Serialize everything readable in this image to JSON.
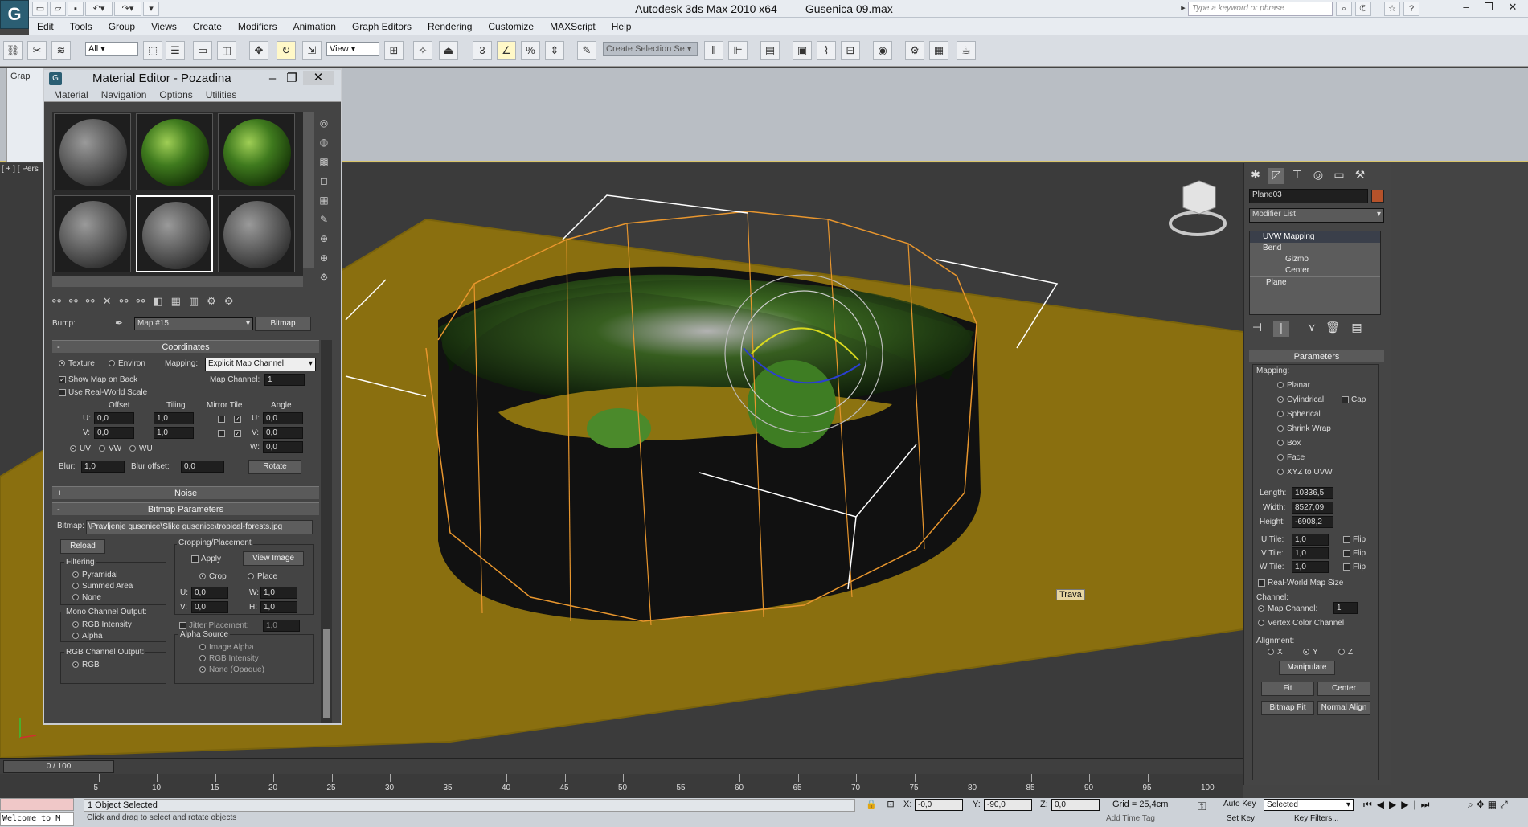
{
  "app": {
    "title": "Autodesk 3ds Max  2010 x64",
    "file": "Gusenica 09.max",
    "search_placeholder": "Type a keyword or phrase"
  },
  "menu": [
    "Edit",
    "Tools",
    "Group",
    "Views",
    "Create",
    "Modifiers",
    "Animation",
    "Graph Editors",
    "Rendering",
    "Customize",
    "MAXScript",
    "Help"
  ],
  "toolbar": {
    "filter": "All",
    "coord": "View",
    "selection_set": "Create Selection Se"
  },
  "viewport": {
    "label": "[ + ] [ Pers",
    "tab_label": "Grap",
    "tooltip": "Trava"
  },
  "material_editor": {
    "title": "Material Editor - Pozadina",
    "menu": [
      "Material",
      "Navigation",
      "Options",
      "Utilities"
    ],
    "bump_label": "Bump:",
    "map_name": "Map #15",
    "map_type": "Bitmap",
    "coordinates": {
      "header": "Coordinates",
      "texture": "Texture",
      "environ": "Environ",
      "mapping_label": "Mapping:",
      "mapping": "Explicit Map Channel",
      "show_map_back": "Show Map on Back",
      "map_channel_label": "Map Channel:",
      "map_channel": "1",
      "real_world": "Use Real-World Scale",
      "offset": "Offset",
      "tiling": "Tiling",
      "mirror_tile": "Mirror Tile",
      "angle": "Angle",
      "u_label": "U:",
      "v_label": "V:",
      "w_label": "W:",
      "u_offset": "0,0",
      "v_offset": "0,0",
      "u_tiling": "1,0",
      "v_tiling": "1,0",
      "u_angle": "0,0",
      "v_angle": "0,0",
      "w_angle": "0,0",
      "uv": "UV",
      "vw": "VW",
      "wu": "WU",
      "blur_label": "Blur:",
      "blur": "1,0",
      "blur_offset_label": "Blur offset:",
      "blur_offset": "0,0",
      "rotate": "Rotate"
    },
    "noise": "Noise",
    "bitmap_params": {
      "header": "Bitmap Parameters",
      "bitmap_label": "Bitmap:",
      "bitmap": "\\Pravljenje gusenice\\Slike gusenice\\tropical-forests.jpg",
      "reload": "Reload",
      "cropping": "Cropping/Placement",
      "apply": "Apply",
      "view_image": "View Image",
      "crop": "Crop",
      "place": "Place",
      "u_label": "U:",
      "v_label": "V:",
      "w_label": "W:",
      "h_label": "H:",
      "u": "0,0",
      "v": "0,0",
      "w": "1,0",
      "h": "1,0",
      "jitter": "Jitter Placement:",
      "jitter_val": "1,0",
      "filtering": "Filtering",
      "pyramidal": "Pyramidal",
      "summed": "Summed Area",
      "none": "None",
      "mono": "Mono Channel Output:",
      "rgb_intensity": "RGB Intensity",
      "alpha": "Alpha",
      "rgb_out": "RGB Channel Output:",
      "rgb": "RGB",
      "alpha_source": "Alpha Source",
      "image_alpha": "Image Alpha",
      "rgb_intensity2": "RGB Intensity",
      "none_opaque": "None (Opaque)"
    }
  },
  "command_panel": {
    "object_name": "Plane03",
    "object_color": "#b5522a",
    "modifier_list": "Modifier List",
    "stack": [
      "UVW Mapping",
      "Bend",
      "Gizmo",
      "Center",
      "Plane"
    ],
    "parameters": "Parameters",
    "mapping_label": "Mapping:",
    "mapping_types": [
      "Planar",
      "Cylindrical",
      "Spherical",
      "Shrink Wrap",
      "Box",
      "Face",
      "XYZ to UVW"
    ],
    "cap": "Cap",
    "length_label": "Length:",
    "length": "10336,5",
    "width_label": "Width:",
    "width": "8527,09",
    "height_label": "Height:",
    "height": "-6908,2",
    "u_tile_label": "U Tile:",
    "u_tile": "1,0",
    "v_tile_label": "V Tile:",
    "v_tile": "1,0",
    "w_tile_label": "W Tile:",
    "w_tile": "1,0",
    "flip": "Flip",
    "real_world": "Real-World Map Size",
    "channel_label": "Channel:",
    "map_channel_label": "Map Channel:",
    "map_channel": "1",
    "vertex_color": "Vertex Color Channel",
    "alignment_label": "Alignment:",
    "x": "X",
    "y": "Y",
    "z": "Z",
    "manipulate": "Manipulate",
    "fit": "Fit",
    "center": "Center",
    "bitmap_fit": "Bitmap Fit",
    "normal_align": "Normal Align"
  },
  "timeline": {
    "position": "0 / 100",
    "ticks": [
      "5",
      "10",
      "15",
      "20",
      "25",
      "30",
      "35",
      "40",
      "45",
      "50",
      "55",
      "60",
      "65",
      "70",
      "75",
      "80",
      "85",
      "90",
      "95",
      "100"
    ]
  },
  "status": {
    "welcome": "Welcome to M",
    "selected": "1 Object Selected",
    "prompt": "Click and drag to select and rotate objects",
    "x_label": "X:",
    "x": "-0,0",
    "y_label": "Y:",
    "y": "-90,0",
    "z_label": "Z:",
    "z": "0,0",
    "grid": "Grid = 25,4cm",
    "add_time_tag": "Add Time Tag",
    "auto_key": "Auto Key",
    "set_key": "Set Key",
    "key_mode": "Selected",
    "key_filters": "Key Filters..."
  }
}
